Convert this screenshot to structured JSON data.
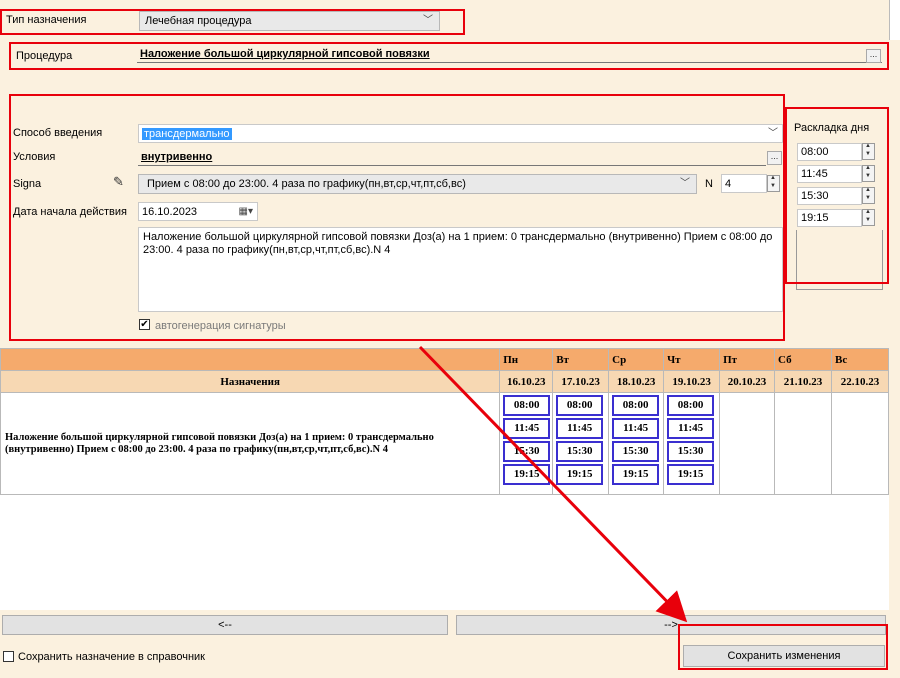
{
  "top": {
    "type_label": "Тип назначения",
    "type_value": "Лечебная процедура",
    "procedure_label": "Процедура",
    "procedure_value": "Наложение большой циркулярной гипсовой повязки",
    "ellipsis": "..."
  },
  "form": {
    "route_label": "Способ введения",
    "route_value": "трансдермально",
    "conditions_label": "Условия",
    "conditions_value": "внутривенно",
    "signa_label": "Signa",
    "signa_value": "Прием с 08:00 до 23:00. 4 раза по графику(пн,вт,ср,чт,пт,сб,вс)",
    "n_label": "N",
    "n_value": "4",
    "start_label": "Дата начала действия",
    "start_value": "16.10.2023",
    "signature_text": "Наложение большой циркулярной гипсовой повязки Доз(а) на 1 прием: 0  трансдермально (внутривенно)  Прием с 08:00 до 23:00. 4 раза по графику(пн,вт,ср,чт,пт,сб,вс).N 4",
    "autogen_label": "автогенерация сигнатуры",
    "autogen_checked": true
  },
  "day_layout": {
    "title": "Раскладка дня",
    "times": [
      "08:00",
      "11:45",
      "15:30",
      "19:15"
    ]
  },
  "schedule": {
    "header_label": "Назначения",
    "days": [
      {
        "short": "Пн",
        "date": "16.10.23",
        "times": [
          "08:00",
          "11:45",
          "15:30",
          "19:15"
        ]
      },
      {
        "short": "Вт",
        "date": "17.10.23",
        "times": [
          "08:00",
          "11:45",
          "15:30",
          "19:15"
        ]
      },
      {
        "short": "Ср",
        "date": "18.10.23",
        "times": [
          "08:00",
          "11:45",
          "15:30",
          "19:15"
        ]
      },
      {
        "short": "Чт",
        "date": "19.10.23",
        "times": [
          "08:00",
          "11:45",
          "15:30",
          "19:15"
        ]
      },
      {
        "short": "Пт",
        "date": "20.10.23",
        "times": []
      },
      {
        "short": "Сб",
        "date": "21.10.23",
        "times": []
      },
      {
        "short": "Вс",
        "date": "22.10.23",
        "times": []
      }
    ],
    "row_text": "Наложение большой циркулярной гипсовой повязки Доз(а) на 1 прием: 0  трансдермально (внутривенно)  Прием с 08:00 до 23:00. 4 раза по графику(пн,вт,ср,чт,пт,сб,вс).N 4"
  },
  "nav": {
    "prev": "<--",
    "next": "-->"
  },
  "footer": {
    "save_to_ref_label": "Сохранить назначение в справочник",
    "save_button": "Сохранить изменения"
  },
  "colors": {
    "annotation_red": "#e8000b",
    "time_box_border": "#3a2fd0",
    "header_orange": "#f5aa6c"
  }
}
